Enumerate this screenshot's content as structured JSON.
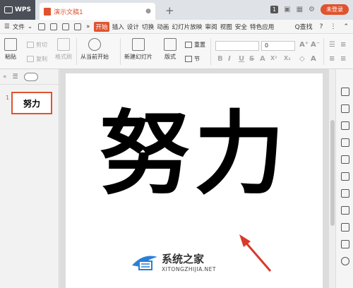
{
  "titlebar": {
    "app_name": "WPS",
    "doc_title": "演示文稿1",
    "close_glyph": "●",
    "new_tab_glyph": "+",
    "badge": "1",
    "login_label": "未登录"
  },
  "menubar": {
    "file_label": "文件",
    "tabs": [
      "开始",
      "插入",
      "设计",
      "切换",
      "动画",
      "幻灯片放映",
      "审阅",
      "视图",
      "安全",
      "特色应用"
    ],
    "active_tab": "开始",
    "search_label": "Q查找",
    "more_glyph": "»"
  },
  "ribbon": {
    "paste_label": "粘贴",
    "cut_label": "剪切",
    "copy_label": "复制",
    "format_painter_label": "格式刷",
    "play_label": "从当前开始",
    "new_slide_label": "新建幻灯片",
    "layout_label": "版式",
    "reset_label": "重置",
    "section_label": "节",
    "font_size_value": "0",
    "format_buttons": [
      "B",
      "I",
      "U",
      "S",
      "A",
      "X²",
      "X₂",
      "A"
    ]
  },
  "panel": {
    "slide_number": "1",
    "thumbnail_text": "努力"
  },
  "slide": {
    "main_text": "努力"
  },
  "watermark": {
    "title": "系统之家",
    "url": "XITONGZHIJIA.NET"
  },
  "colors": {
    "accent": "#e0532f",
    "arrow": "#d93a2b"
  }
}
